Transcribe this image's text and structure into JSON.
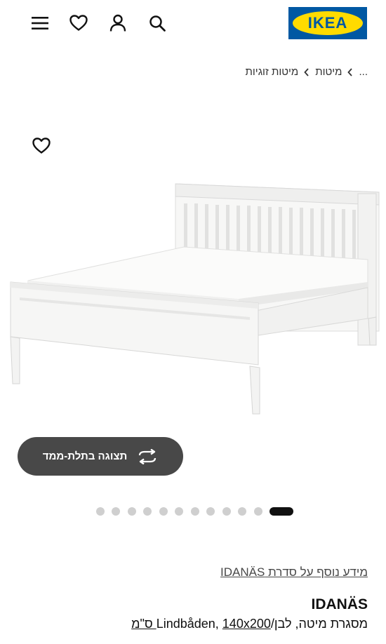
{
  "header": {
    "logo_text": "IKEA",
    "brand_blue": "#0058a3",
    "brand_yellow": "#ffdb00",
    "icons": [
      "menu-icon",
      "heart-icon",
      "user-icon",
      "search-icon"
    ]
  },
  "breadcrumb": {
    "items": [
      "...",
      "מיטות",
      "מיטות זוגיות"
    ],
    "separator_icon": "chevron-right-icon"
  },
  "gallery": {
    "favorite_icon": "heart-icon",
    "view_3d_label": "תצוגה בתלת-ממד",
    "view_3d_icon": "rotate-icon",
    "image_count": 12,
    "active_image": 1
  },
  "product": {
    "series_link": "מידע נוסף על סדרת IDANÄS",
    "name": "IDANÄS",
    "description": "מסגרת מיטה, לבן/Lindbåden,",
    "size": "140x200 ס\"מ"
  }
}
